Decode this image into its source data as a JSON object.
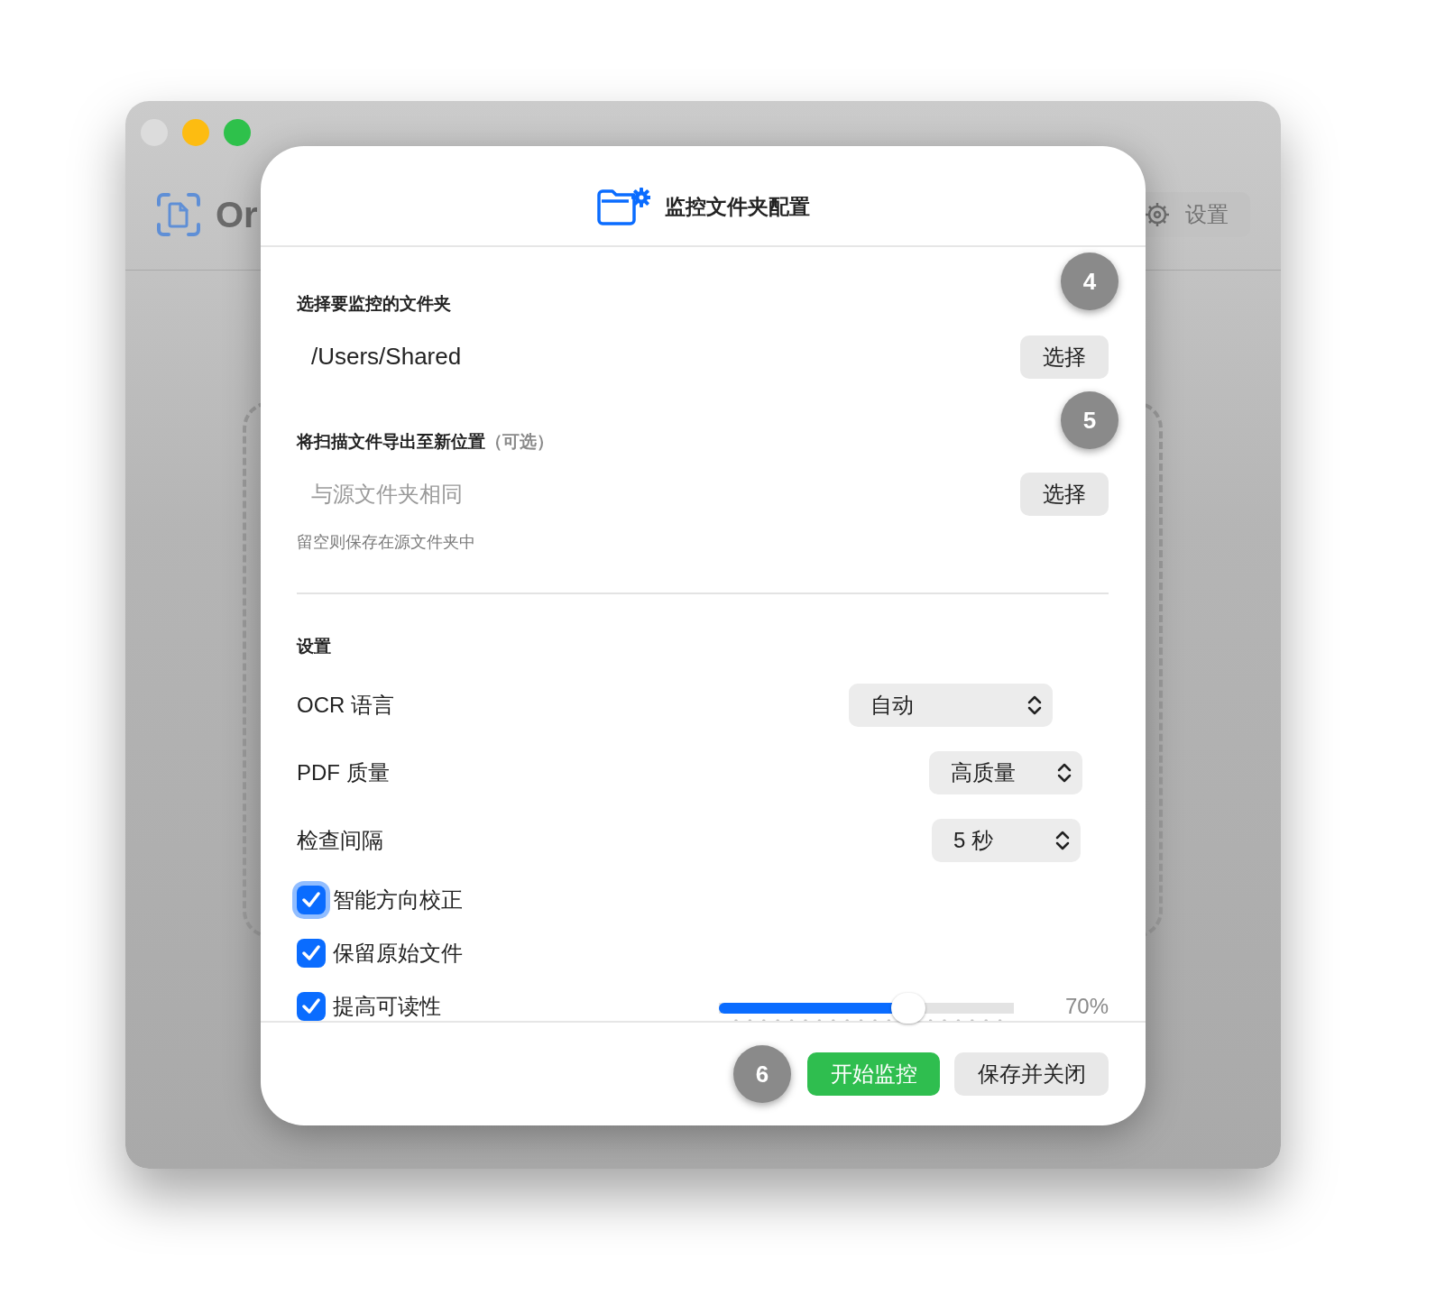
{
  "window": {
    "traffic_lights": [
      {
        "color": "#dcdcdc"
      },
      {
        "color": "#fdbc11"
      },
      {
        "color": "#2ec14b"
      }
    ],
    "app_title": "Or",
    "settings_button": "设置"
  },
  "dialog": {
    "title": "监控文件夹配置",
    "source": {
      "label": "选择要监控的文件夹",
      "value": "/Users/Shared",
      "button": "选择",
      "callout": "4"
    },
    "export": {
      "label": "将扫描文件导出至新位置",
      "label_note": "（可选）",
      "placeholder": "与源文件夹相同",
      "button": "选择",
      "hint": "留空则保存在源文件夹中",
      "callout": "5"
    },
    "settings": {
      "heading": "设置",
      "selects": [
        {
          "label": "OCR 语言",
          "value": "自动"
        },
        {
          "label": "PDF 质量",
          "value": "高质量"
        },
        {
          "label": "检查间隔",
          "value": "5 秒"
        }
      ],
      "options": [
        {
          "label": "智能方向校正",
          "checked": true,
          "focused": true
        },
        {
          "label": "保留原始文件",
          "checked": true,
          "focused": false
        },
        {
          "label": "提高可读性",
          "checked": true,
          "focused": false,
          "slider": {
            "level": 0.66,
            "reading": "70%"
          }
        }
      ]
    },
    "footer": {
      "callout": "6",
      "primary_button": "开始监控",
      "secondary_button": "保存并关闭"
    }
  }
}
